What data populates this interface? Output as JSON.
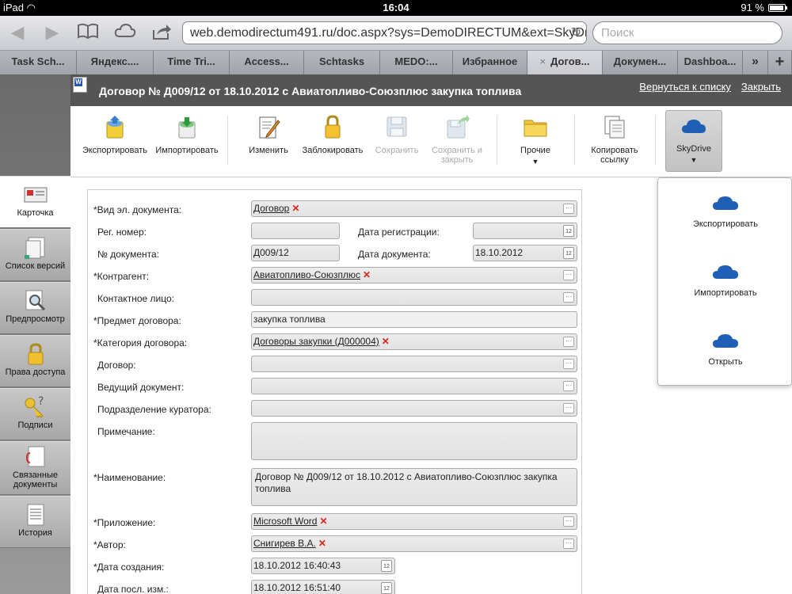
{
  "status": {
    "device": "iPad",
    "time": "16:04",
    "battery": "91 %"
  },
  "browser": {
    "url": "web.demodirectum491.ru/doc.aspx?sys=DemoDIRECTUM&ext=SkyDrive",
    "search_placeholder": "Поиск",
    "tabs": [
      "Task Sch...",
      "Яндекс....",
      "Time Tri...",
      "Access...",
      "Schtasks",
      "MEDO:...",
      "Избранное",
      "Догов...",
      "Докумен...",
      "Dashboa..."
    ],
    "tab_close": "×",
    "more_tabs": "»",
    "new_tab": "+"
  },
  "app": {
    "title": "Договор № Д009/12 от 18.10.2012 с Авиатопливо-Союзплюс закупка топлива",
    "link_back": "Вернуться к списку",
    "link_close": "Закрыть",
    "word_icon_letter": "W"
  },
  "toolbar": {
    "export": "Экспортировать",
    "import": "Импортировать",
    "edit": "Изменить",
    "lock": "Заблокировать",
    "save": "Сохранить",
    "save_close_1": "Сохранить и",
    "save_close_2": "закрыть",
    "other": "Прочие",
    "copy_1": "Копировать",
    "copy_2": "ссылку",
    "skydrive": "SkyDrive"
  },
  "sidebar": {
    "card": "Карточка",
    "versions": "Список версий",
    "preview": "Предпросмотр",
    "access": "Права доступа",
    "signatures": "Подписи",
    "linked_1": "Связанные",
    "linked_2": "документы",
    "history": "История"
  },
  "form": {
    "doc_type_label": "*Вид эл. документа:",
    "doc_type_value": "Договор",
    "reg_no_label": "Рег. номер:",
    "reg_no_value": "",
    "reg_date_label": "Дата регистрации:",
    "reg_date_value": "",
    "doc_no_label": "№ документа:",
    "doc_no_value": "Д009/12",
    "doc_date_label": "Дата документа:",
    "doc_date_value": "18.10.2012",
    "contractor_label": "*Контрагент:",
    "contractor_value": "Авиатопливо-Союзплюс",
    "contact_label": "Контактное лицо:",
    "contact_value": "",
    "subject_label": "*Предмет договора:",
    "subject_value": "закупка топлива",
    "category_label": "*Категория договора:",
    "category_value": "Договоры закупки (Д000004)",
    "contract_label": "Договор:",
    "contract_value": "",
    "lead_doc_label": "Ведущий документ:",
    "lead_doc_value": "",
    "dept_label": "Подразделение куратора:",
    "dept_value": "",
    "note_label": "Примечание:",
    "note_value": "",
    "name_label": "*Наименование:",
    "name_value": "Договор № Д009/12 от 18.10.2012 с Авиатопливо-Союзплюс закупка топлива",
    "app_label": "*Приложение:",
    "app_value": "Microsoft Word",
    "author_label": "*Автор:",
    "author_value": "Снигирев В.А.",
    "created_label": "*Дата создания:",
    "created_value": "18.10.2012 16:40:43",
    "modified_label": "Дата посл. изм.:",
    "modified_value": "18.10.2012 16:51:40",
    "cal_text": "12",
    "dots_text": "···",
    "remove_mark": "✕"
  },
  "skydrive_menu": {
    "export": "Экспортировать",
    "import": "Импортировать",
    "open": "Открыть"
  },
  "colors": {
    "skydrive_blue": "#1f5fb5",
    "remove_red": "#d9261c",
    "header_bg": "#555555"
  }
}
